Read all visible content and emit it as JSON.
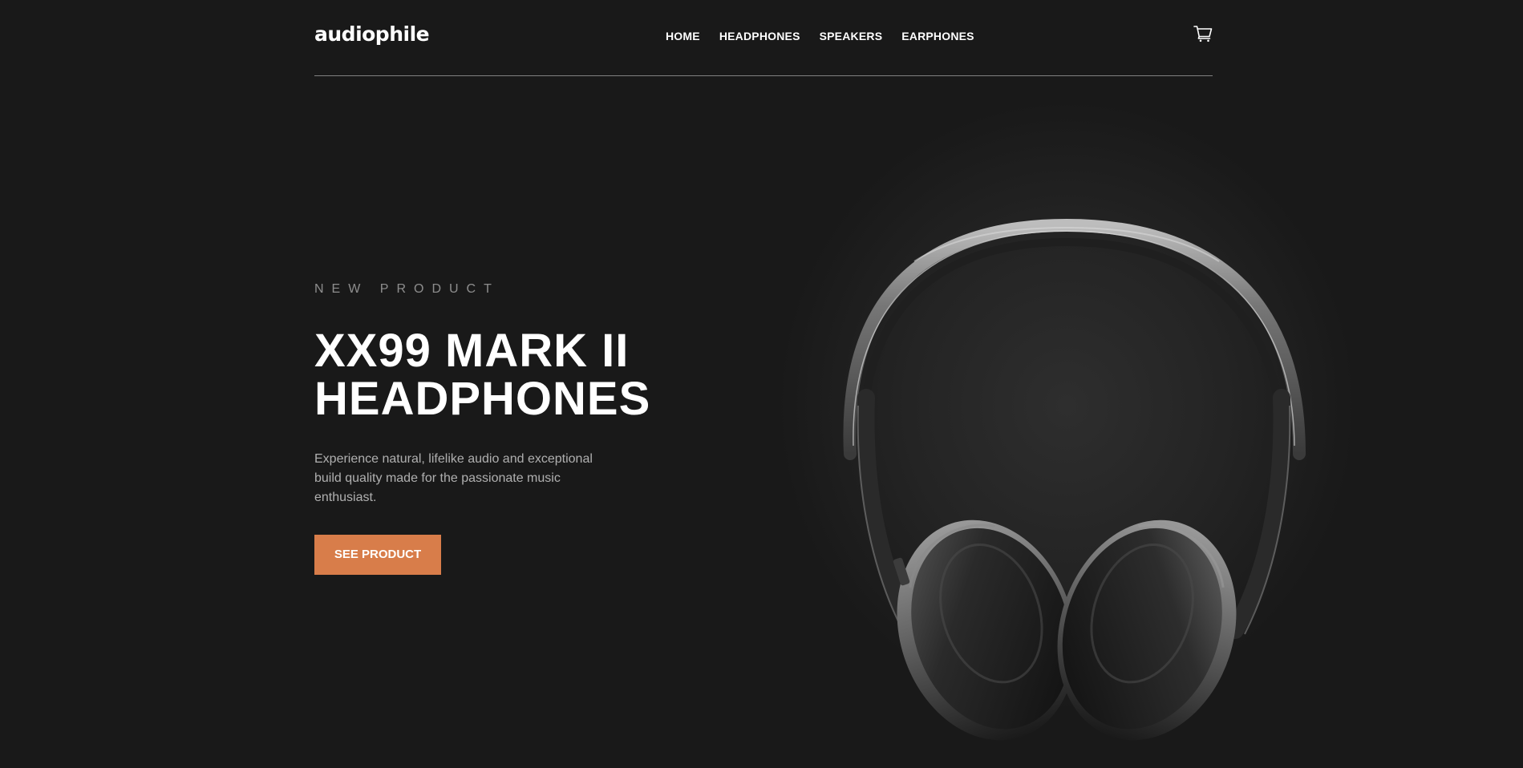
{
  "header": {
    "logo": "audiophile",
    "nav": [
      {
        "label": "HOME"
      },
      {
        "label": "HEADPHONES"
      },
      {
        "label": "SPEAKERS"
      },
      {
        "label": "EARPHONES"
      }
    ],
    "cart_icon": "cart-icon"
  },
  "hero": {
    "overline": "NEW PRODUCT",
    "title_line1": "XX99 MARK II",
    "title_line2": "HEADPHONES",
    "description": "Experience natural, lifelike audio and exceptional build quality made for the passionate music enthusiast.",
    "cta_label": "SEE PRODUCT",
    "image_icon": "headphones-image"
  },
  "colors": {
    "background": "#191919",
    "accent": "#d87d4a",
    "text": "#ffffff"
  }
}
